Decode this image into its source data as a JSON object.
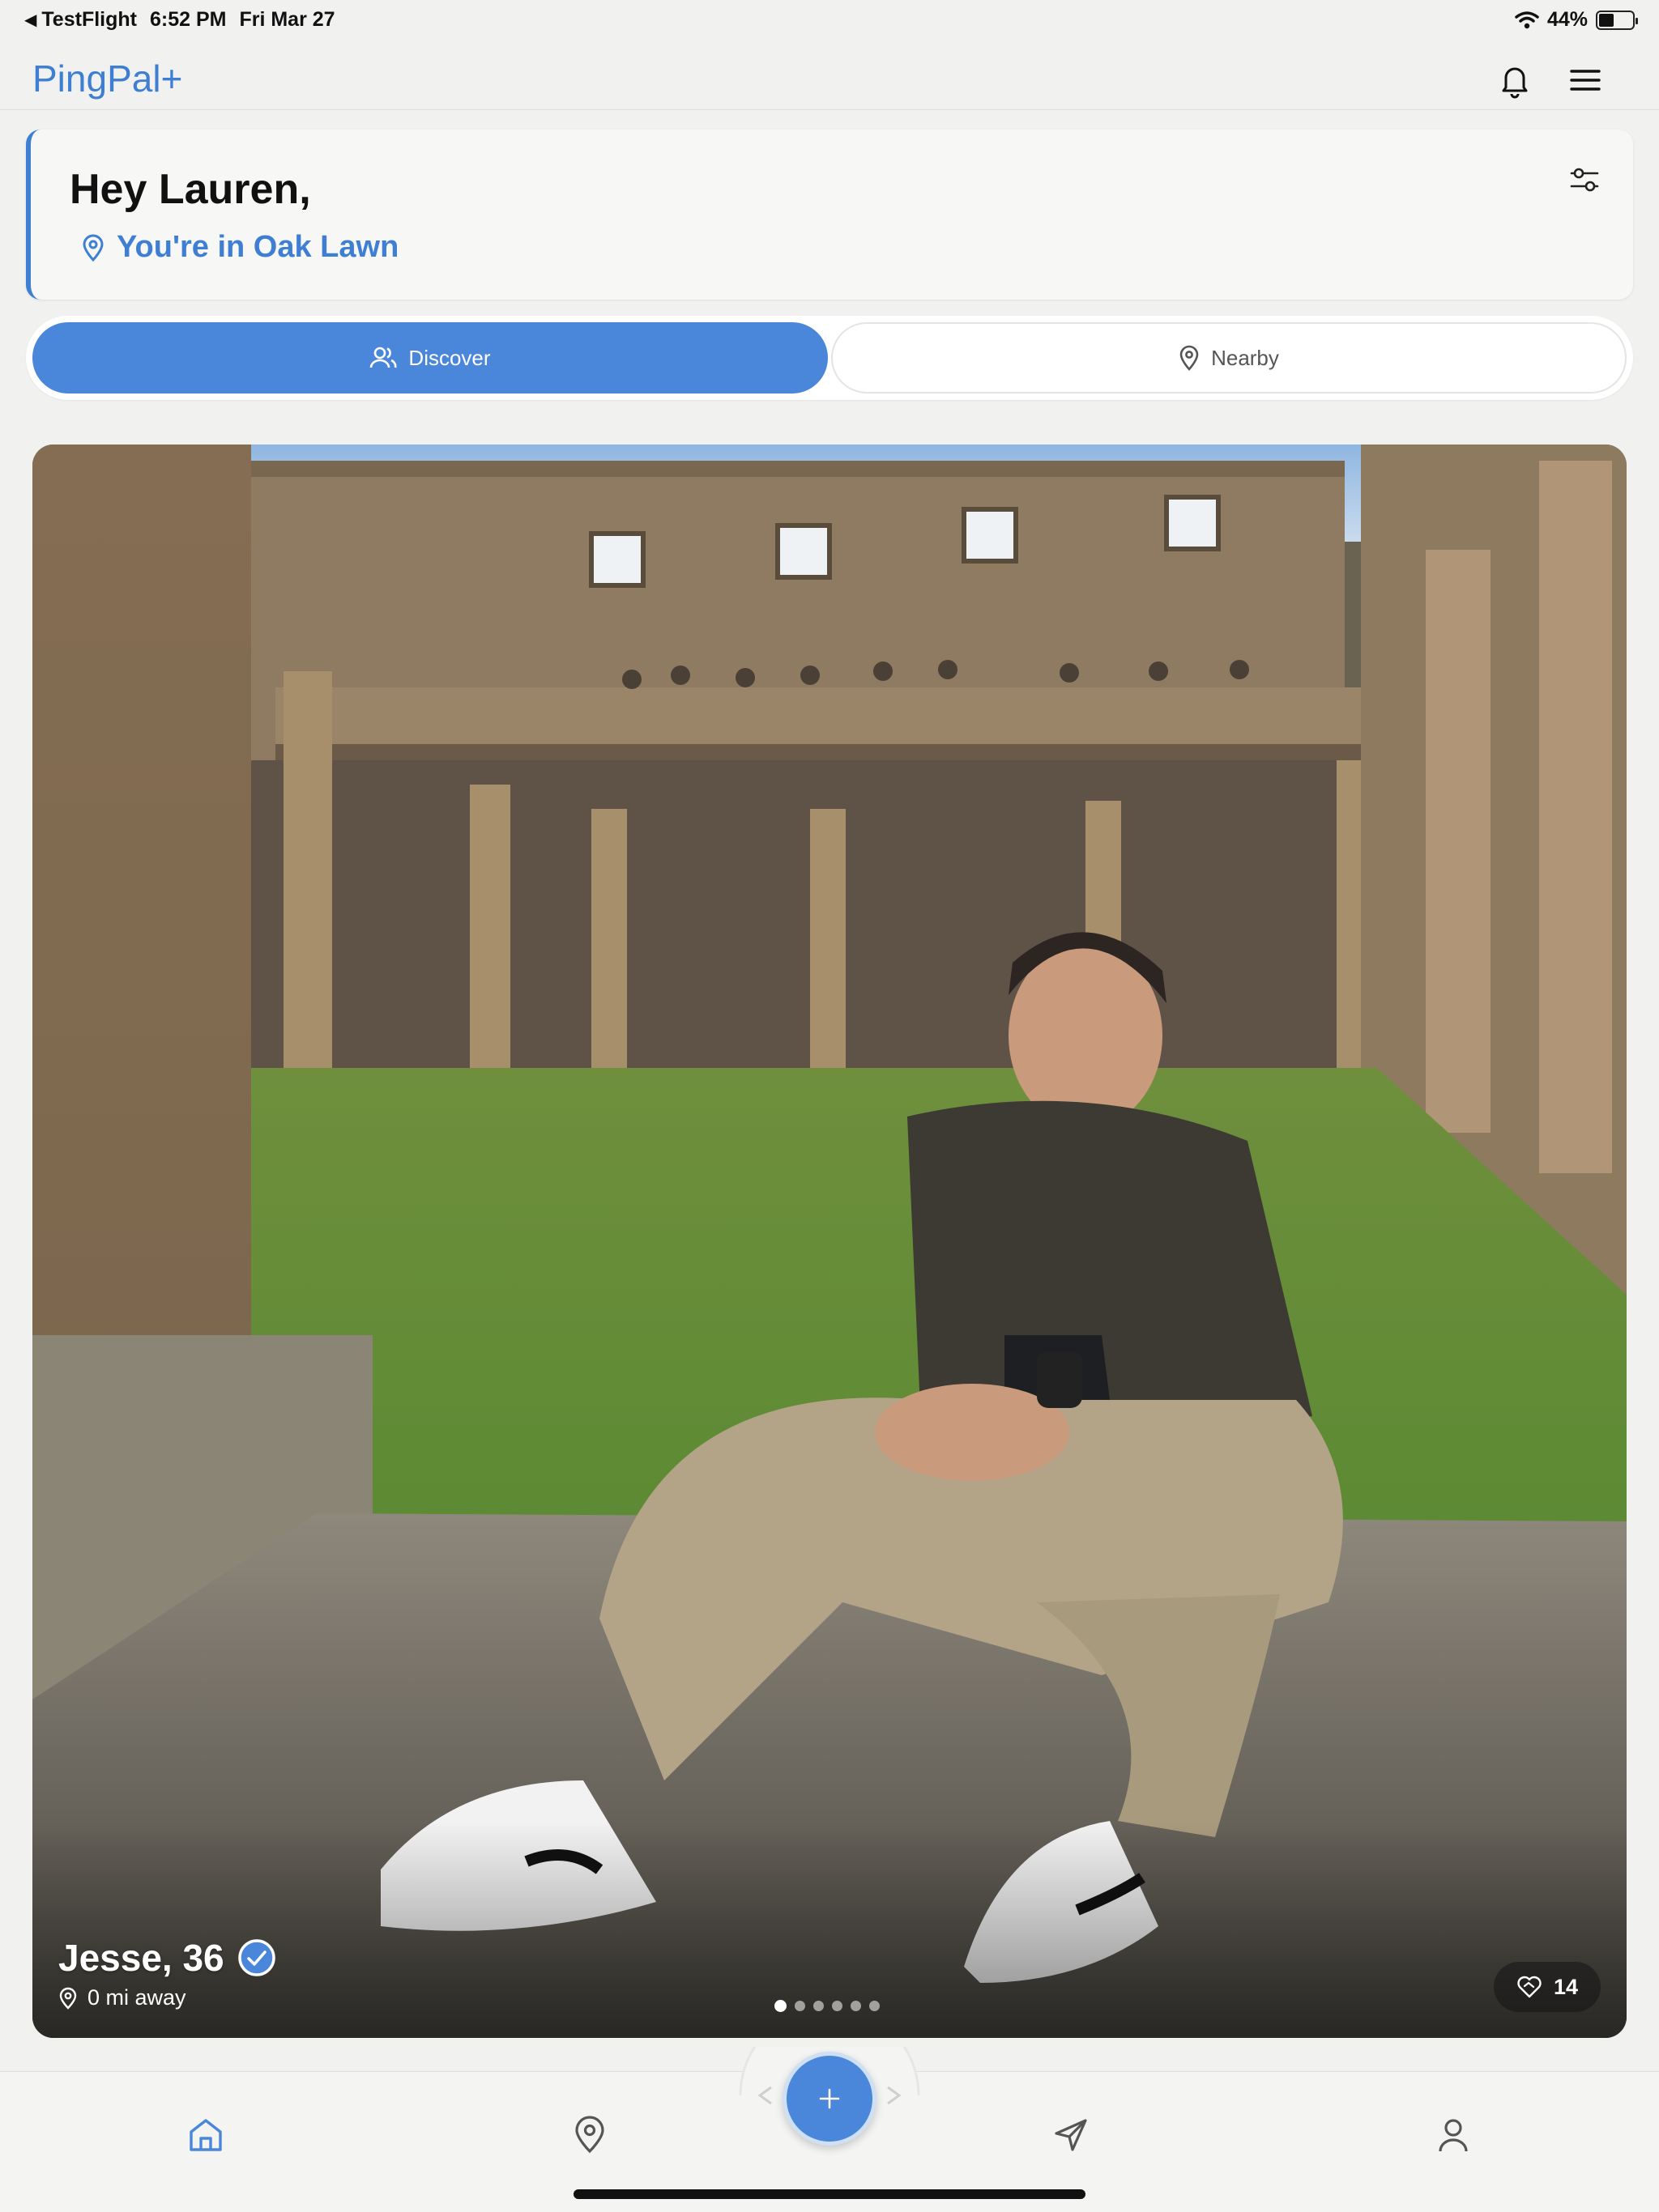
{
  "status": {
    "back_app": "TestFlight",
    "time": "6:52 PM",
    "date": "Fri Mar 27",
    "battery_text": "44%",
    "battery_level": 0.44
  },
  "nav": {
    "brand": "PingPal+"
  },
  "greeting": {
    "title": "Hey Lauren,",
    "location": "You're in Oak Lawn"
  },
  "tabs": [
    {
      "label": "Discover",
      "active": true
    },
    {
      "label": "Nearby",
      "active": false
    }
  ],
  "profile": {
    "name_age": "Jesse, 36",
    "distance": "0 mi away",
    "likes": "14",
    "photo_count": 6,
    "current_photo": 1
  },
  "colors": {
    "accent": "#4a86d9",
    "brand": "#3e7fd4"
  },
  "icons": {
    "nav": [
      "bell-icon",
      "menu-icon"
    ],
    "tabbar": [
      "home-icon",
      "map-pin-icon",
      "plus-icon",
      "send-icon",
      "profile-icon"
    ]
  }
}
